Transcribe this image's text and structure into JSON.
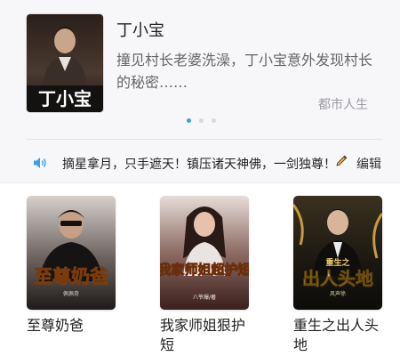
{
  "featured": {
    "cover_text": "丁小宝",
    "title": "丁小宝",
    "description": "撞见村长老婆洗澡，丁小宝意外发现村长的秘密……",
    "genre": "都市人生",
    "dots": 3,
    "active_dot": 0
  },
  "notice": {
    "icon": "speaker-icon",
    "text": "摘星拿月，只手遮天！镇压诸天神佛，一剑独尊！",
    "edit_icon": "pencil-icon",
    "edit_label": "编辑"
  },
  "books": [
    {
      "title": "至尊奶爸",
      "cover_text": "至尊奶爸",
      "cover_subtext": "佩佩奇"
    },
    {
      "title": "我家师姐狠护短",
      "cover_text": "我家师姐超护短",
      "cover_subtext": "八爷爆/著"
    },
    {
      "title": "重生之出人头地",
      "cover_text": "出人头地",
      "cover_subtext": "重生之",
      "cover_author": "风声徐"
    }
  ],
  "colors": {
    "accent": "#3aa0ea",
    "text_primary": "#222222",
    "text_secondary": "#666666",
    "top_card_bg": "#f7f7f9"
  }
}
